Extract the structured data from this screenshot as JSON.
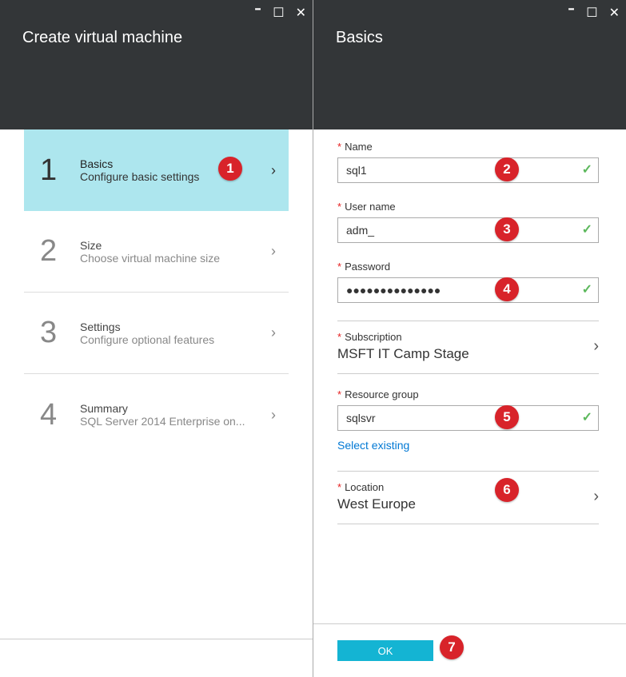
{
  "leftPanel": {
    "title": "Create virtual machine",
    "steps": [
      {
        "num": "1",
        "title": "Basics",
        "sub": "Configure basic settings"
      },
      {
        "num": "2",
        "title": "Size",
        "sub": "Choose virtual machine size"
      },
      {
        "num": "3",
        "title": "Settings",
        "sub": "Configure optional features"
      },
      {
        "num": "4",
        "title": "Summary",
        "sub": "SQL Server 2014 Enterprise on..."
      }
    ]
  },
  "rightPanel": {
    "title": "Basics",
    "name": {
      "label": "Name",
      "value": "sql1"
    },
    "username": {
      "label": "User name",
      "value": "adm_"
    },
    "password": {
      "label": "Password",
      "value": "●●●●●●●●●●●●●●"
    },
    "subscription": {
      "label": "Subscription",
      "value": "MSFT IT Camp Stage"
    },
    "resourceGroup": {
      "label": "Resource group",
      "value": "sqlsvr",
      "link": "Select existing"
    },
    "location": {
      "label": "Location",
      "value": "West Europe"
    },
    "ok": "OK"
  },
  "badges": [
    "1",
    "2",
    "3",
    "4",
    "5",
    "6",
    "7"
  ]
}
